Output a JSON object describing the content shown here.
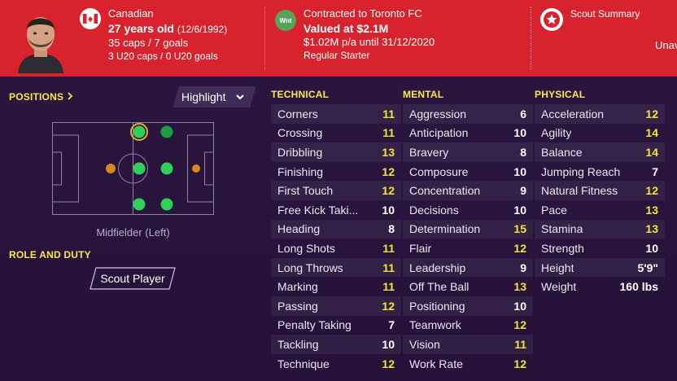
{
  "header": {
    "nationality": "Canadian",
    "age": "27 years old",
    "dob": "(12/6/1992)",
    "caps": "35 caps / 7 goals",
    "u20": "3 U20 caps / 0 U20 goals",
    "club_badge_text": "Wnt",
    "contract": "Contracted to Toronto FC",
    "value": "Valued at $2.1M",
    "wage": "$1.02M p/a until 31/12/2020",
    "status": "Regular Starter",
    "scout_summary": "Scout Summary",
    "cut_text": "Unav"
  },
  "positions": {
    "title": "POSITIONS",
    "highlight_label": "Highlight",
    "position_name": "Midfielder (Left)"
  },
  "role": {
    "title": "ROLE AND DUTY",
    "button_label": "Scout Player"
  },
  "technical": {
    "title": "TECHNICAL",
    "rows": [
      {
        "name": "Corners",
        "value": "11"
      },
      {
        "name": "Crossing",
        "value": "11"
      },
      {
        "name": "Dribbling",
        "value": "13"
      },
      {
        "name": "Finishing",
        "value": "12"
      },
      {
        "name": "First Touch",
        "value": "12"
      },
      {
        "name": "Free Kick Taki...",
        "value": "10"
      },
      {
        "name": "Heading",
        "value": "8"
      },
      {
        "name": "Long Shots",
        "value": "11"
      },
      {
        "name": "Long Throws",
        "value": "11"
      },
      {
        "name": "Marking",
        "value": "11"
      },
      {
        "name": "Passing",
        "value": "12"
      },
      {
        "name": "Penalty Taking",
        "value": "7"
      },
      {
        "name": "Tackling",
        "value": "10"
      },
      {
        "name": "Technique",
        "value": "12"
      }
    ]
  },
  "mental": {
    "title": "MENTAL",
    "rows": [
      {
        "name": "Aggression",
        "value": "6"
      },
      {
        "name": "Anticipation",
        "value": "10"
      },
      {
        "name": "Bravery",
        "value": "8"
      },
      {
        "name": "Composure",
        "value": "10"
      },
      {
        "name": "Concentration",
        "value": "9"
      },
      {
        "name": "Decisions",
        "value": "10"
      },
      {
        "name": "Determination",
        "value": "15"
      },
      {
        "name": "Flair",
        "value": "12"
      },
      {
        "name": "Leadership",
        "value": "9"
      },
      {
        "name": "Off The Ball",
        "value": "13"
      },
      {
        "name": "Positioning",
        "value": "10"
      },
      {
        "name": "Teamwork",
        "value": "12"
      },
      {
        "name": "Vision",
        "value": "11"
      },
      {
        "name": "Work Rate",
        "value": "12"
      }
    ]
  },
  "physical": {
    "title": "PHYSICAL",
    "rows": [
      {
        "name": "Acceleration",
        "value": "12"
      },
      {
        "name": "Agility",
        "value": "14"
      },
      {
        "name": "Balance",
        "value": "14"
      },
      {
        "name": "Jumping Reach",
        "value": "7"
      },
      {
        "name": "Natural Fitness",
        "value": "12"
      },
      {
        "name": "Pace",
        "value": "13"
      },
      {
        "name": "Stamina",
        "value": "13"
      },
      {
        "name": "Strength",
        "value": "10"
      },
      {
        "name": "Height",
        "value": "5'9\""
      },
      {
        "name": "Weight",
        "value": "160 lbs"
      }
    ]
  },
  "colors": {
    "header_red": "#d8232e",
    "accent_yellow": "#f6e94a",
    "background": "#2a1640",
    "position_natural": "#2fcf5a",
    "position_accomplished": "#1f9e44",
    "position_weak": "#d68a1c"
  },
  "icons": {
    "flag": "canada-flag-icon",
    "club": "club-badge-icon",
    "scout": "star-icon",
    "dropdown": "chevron-down-icon",
    "positions_link": "chevron-right-icon"
  }
}
